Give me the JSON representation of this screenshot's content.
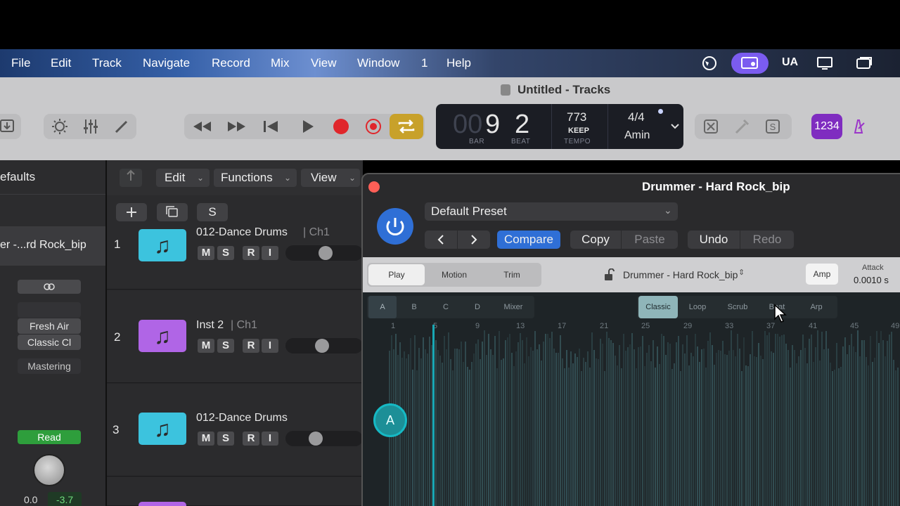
{
  "menubar": {
    "items": [
      "File",
      "Edit",
      "Track",
      "Navigate",
      "Record",
      "Mix",
      "View",
      "Window",
      "1",
      "Help"
    ],
    "user_label": "UA"
  },
  "window": {
    "title": "Untitled - Tracks"
  },
  "transport": {
    "bar_dim": "00",
    "bar": "9",
    "beat": "2",
    "bar_label": "BAR",
    "beat_label": "BEAT",
    "tempo": "773",
    "tempo_mode": "KEEP",
    "tempo_label": "TEMPO",
    "signature": "4/4",
    "key": "Amin",
    "count_in_label": "1234"
  },
  "inspector": {
    "header": "efaults",
    "region_name": "er -...rd Rock_bip",
    "plugin_slots": [
      "Fresh Air",
      "Classic Cl"
    ],
    "mastering": "Mastering",
    "automation": "Read",
    "volume": "0.0",
    "peak": "-3.7"
  },
  "tracks_toolbar": {
    "edit": "Edit",
    "functions": "Functions",
    "view": "View",
    "solo": "S"
  },
  "tracks": [
    {
      "number": "1",
      "name": "012-Dance Drums",
      "channel": "| Ch1",
      "color": "#3cc3de"
    },
    {
      "number": "2",
      "name": "Inst 2",
      "channel": "| Ch1",
      "color": "#b065e6"
    },
    {
      "number": "3",
      "name": "012-Dance Drums",
      "channel": "",
      "color": "#3cc3de"
    }
  ],
  "track_buttons": [
    "M",
    "S",
    "R",
    "I"
  ],
  "plugin": {
    "title": "Drummer - Hard Rock_bip",
    "preset": "Default Preset",
    "compare": "Compare",
    "copy": "Copy",
    "paste": "Paste",
    "undo": "Undo",
    "redo": "Redo",
    "tabs": [
      "Play",
      "Motion",
      "Trim"
    ],
    "drummer_name": "Drummer - Hard Rock_bip",
    "amp": "Amp",
    "attack_label": "Attack",
    "attack_value": "0.0010 s",
    "pattern_tabs": [
      "A",
      "B",
      "C",
      "D",
      "Mixer"
    ],
    "mode_tabs": [
      "Classic",
      "Loop",
      "Scrub",
      "Beat",
      "Arp"
    ],
    "ruler": [
      "1",
      "5",
      "9",
      "13",
      "17",
      "21",
      "25",
      "29",
      "33",
      "37",
      "41",
      "45",
      "49"
    ],
    "section_marker": "A"
  },
  "colors": {
    "accent_blue": "#2f6fd6",
    "record_red": "#e0262b",
    "cycle_yellow": "#c8a12a",
    "read_green": "#2e9e3c",
    "count_in_purple": "#7f2cc0",
    "waveform_teal": "#5aa0a8"
  }
}
